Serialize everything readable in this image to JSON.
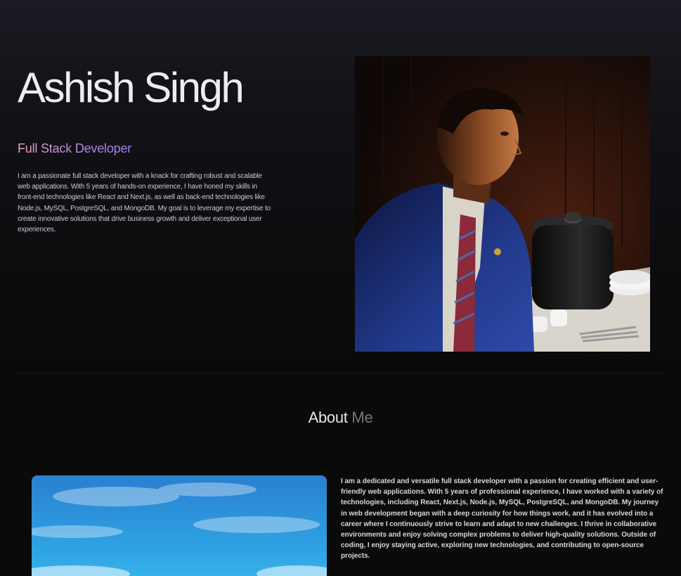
{
  "hero": {
    "name": "Ashish Singh",
    "role": "Full Stack Developer",
    "bio": "I am a passionate full stack developer with a knack for crafting robust and scalable web applications. With 5 years of hands-on experience, I have honed my skills in front-end technologies like React and Next.js, as well as back-end technologies like Node.js, MySQL, PostgreSQL, and MongoDB. My goal is to leverage my expertise to create innovative solutions that drive business growth and deliver exceptional user experiences."
  },
  "about": {
    "heading_primary": "About",
    "heading_secondary": "Me",
    "text": "I am a dedicated and versatile full stack developer with a passion for creating efficient and user-friendly web applications. With 5 years of professional experience, I have worked with a variety of technologies, including React, Next.js, Node.js, MySQL, PostgreSQL, and MongoDB. My journey in web development began with a deep curiosity for how things work, and it has evolved into a career where I continuously strive to learn and adapt to new challenges. I thrive in collaborative environments and enjoy solving complex problems to deliver high-quality solutions. Outside of coding, I enjoy staying active, exploring new technologies, and contributing to open-source projects."
  },
  "colors": {
    "background": "#0a0a0a",
    "role_gradient_start": "#e7a6c4",
    "role_gradient_end": "#a27ef0",
    "heading_muted": "#77777d"
  }
}
